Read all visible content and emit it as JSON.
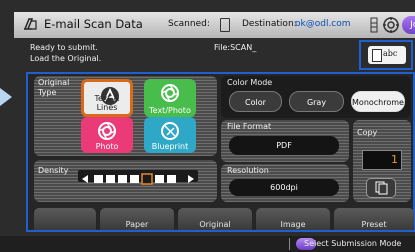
{
  "header": {
    "title": "E-mail Scan Data",
    "scanned_label": "Scanned:",
    "destination_label": "Destination:",
    "destination_value": "ok@odl.com",
    "job_button_label": "Job"
  },
  "status": {
    "line1": "Ready to submit.",
    "line2": "Load the Original.",
    "file_name": "File:SCAN_"
  },
  "preview": {
    "label": "abc"
  },
  "original": {
    "label_line1": "Original",
    "label_line2": "Type",
    "options": [
      "Text & Lines",
      "Text/Photo",
      "Photo",
      "Blueprint"
    ],
    "selected": "Text & Lines"
  },
  "density": {
    "label": "Density",
    "level_of_7": 5
  },
  "color_mode": {
    "label": "Color Mode",
    "options": [
      "Color",
      "Gray",
      "Monochrome"
    ],
    "selected": "Monochrome"
  },
  "file_format": {
    "label": "File Format",
    "value": "PDF"
  },
  "resolution": {
    "label": "Resolution",
    "value": "600dpi"
  },
  "copy": {
    "label": "Copy",
    "value": "1"
  },
  "tabs": [
    "",
    "Paper",
    "Original",
    "Image",
    "Preset"
  ],
  "footer": {
    "select_submission_mode": "Select Submission Mode"
  },
  "colors": {
    "accent_blue": "#1f5fd0",
    "selected_orange": "#d86a1a",
    "green": "#48bd4c",
    "pink": "#eb3a78",
    "cyan": "#2fa8c7",
    "purple": "#8a5ad9"
  }
}
